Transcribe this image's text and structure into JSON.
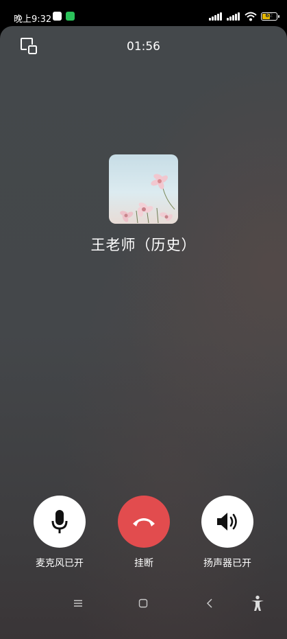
{
  "status_bar": {
    "time": "晚上9:32",
    "battery_level": "62",
    "icons": [
      "qq-icon",
      "wechat-icon",
      "signal-icon",
      "signal-icon",
      "wifi-icon",
      "battery-icon"
    ]
  },
  "call": {
    "duration": "01:56",
    "contact_name": "王老师（历史）",
    "top_icon": "minimize-window-icon"
  },
  "controls": [
    {
      "label": "麦克风已开",
      "icon": "microphone-icon",
      "style": "white"
    },
    {
      "label": "挂断",
      "icon": "hang-up-icon",
      "style": "red"
    },
    {
      "label": "扬声器已开",
      "icon": "speaker-icon",
      "style": "white"
    }
  ],
  "nav_bar": {
    "icons": [
      "menu-icon",
      "home-icon",
      "back-icon",
      "accessibility-icon"
    ]
  },
  "colors": {
    "hangup": "#e24c4e",
    "background": "#44484b",
    "battery": "#e6b800",
    "wechat": "#2bc25a"
  }
}
